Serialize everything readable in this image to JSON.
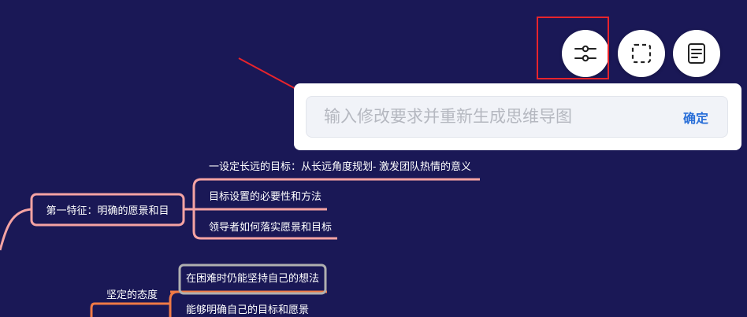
{
  "toolbar": {
    "adjust_icon": "sliders-icon",
    "select_icon": "dashed-select-icon",
    "document_icon": "document-icon"
  },
  "regenerate_panel": {
    "placeholder": "输入修改要求并重新生成思维导图",
    "confirm_label": "确定"
  },
  "mindmap": {
    "branch1": {
      "label": "第一特征：明确的愿景和目",
      "children": [
        "一设定长远的目标：从长远角度规划- 激发团队热情的意义",
        "目标设置的必要性和方法",
        "领导者如何落实愿景和目标"
      ]
    },
    "branch2": {
      "label": "坚定的态度",
      "children": [
        "在困难时仍能坚持自己的想法",
        "能够明确自己的目标和愿景"
      ]
    }
  },
  "colors": {
    "background": "#1a1856",
    "branch1_line": "#f5a3a3",
    "branch2_line": "#f07a45",
    "highlight_border": "#b0b0b0",
    "annotation_red": "#e8242c",
    "confirm_blue": "#2a6fd8"
  }
}
